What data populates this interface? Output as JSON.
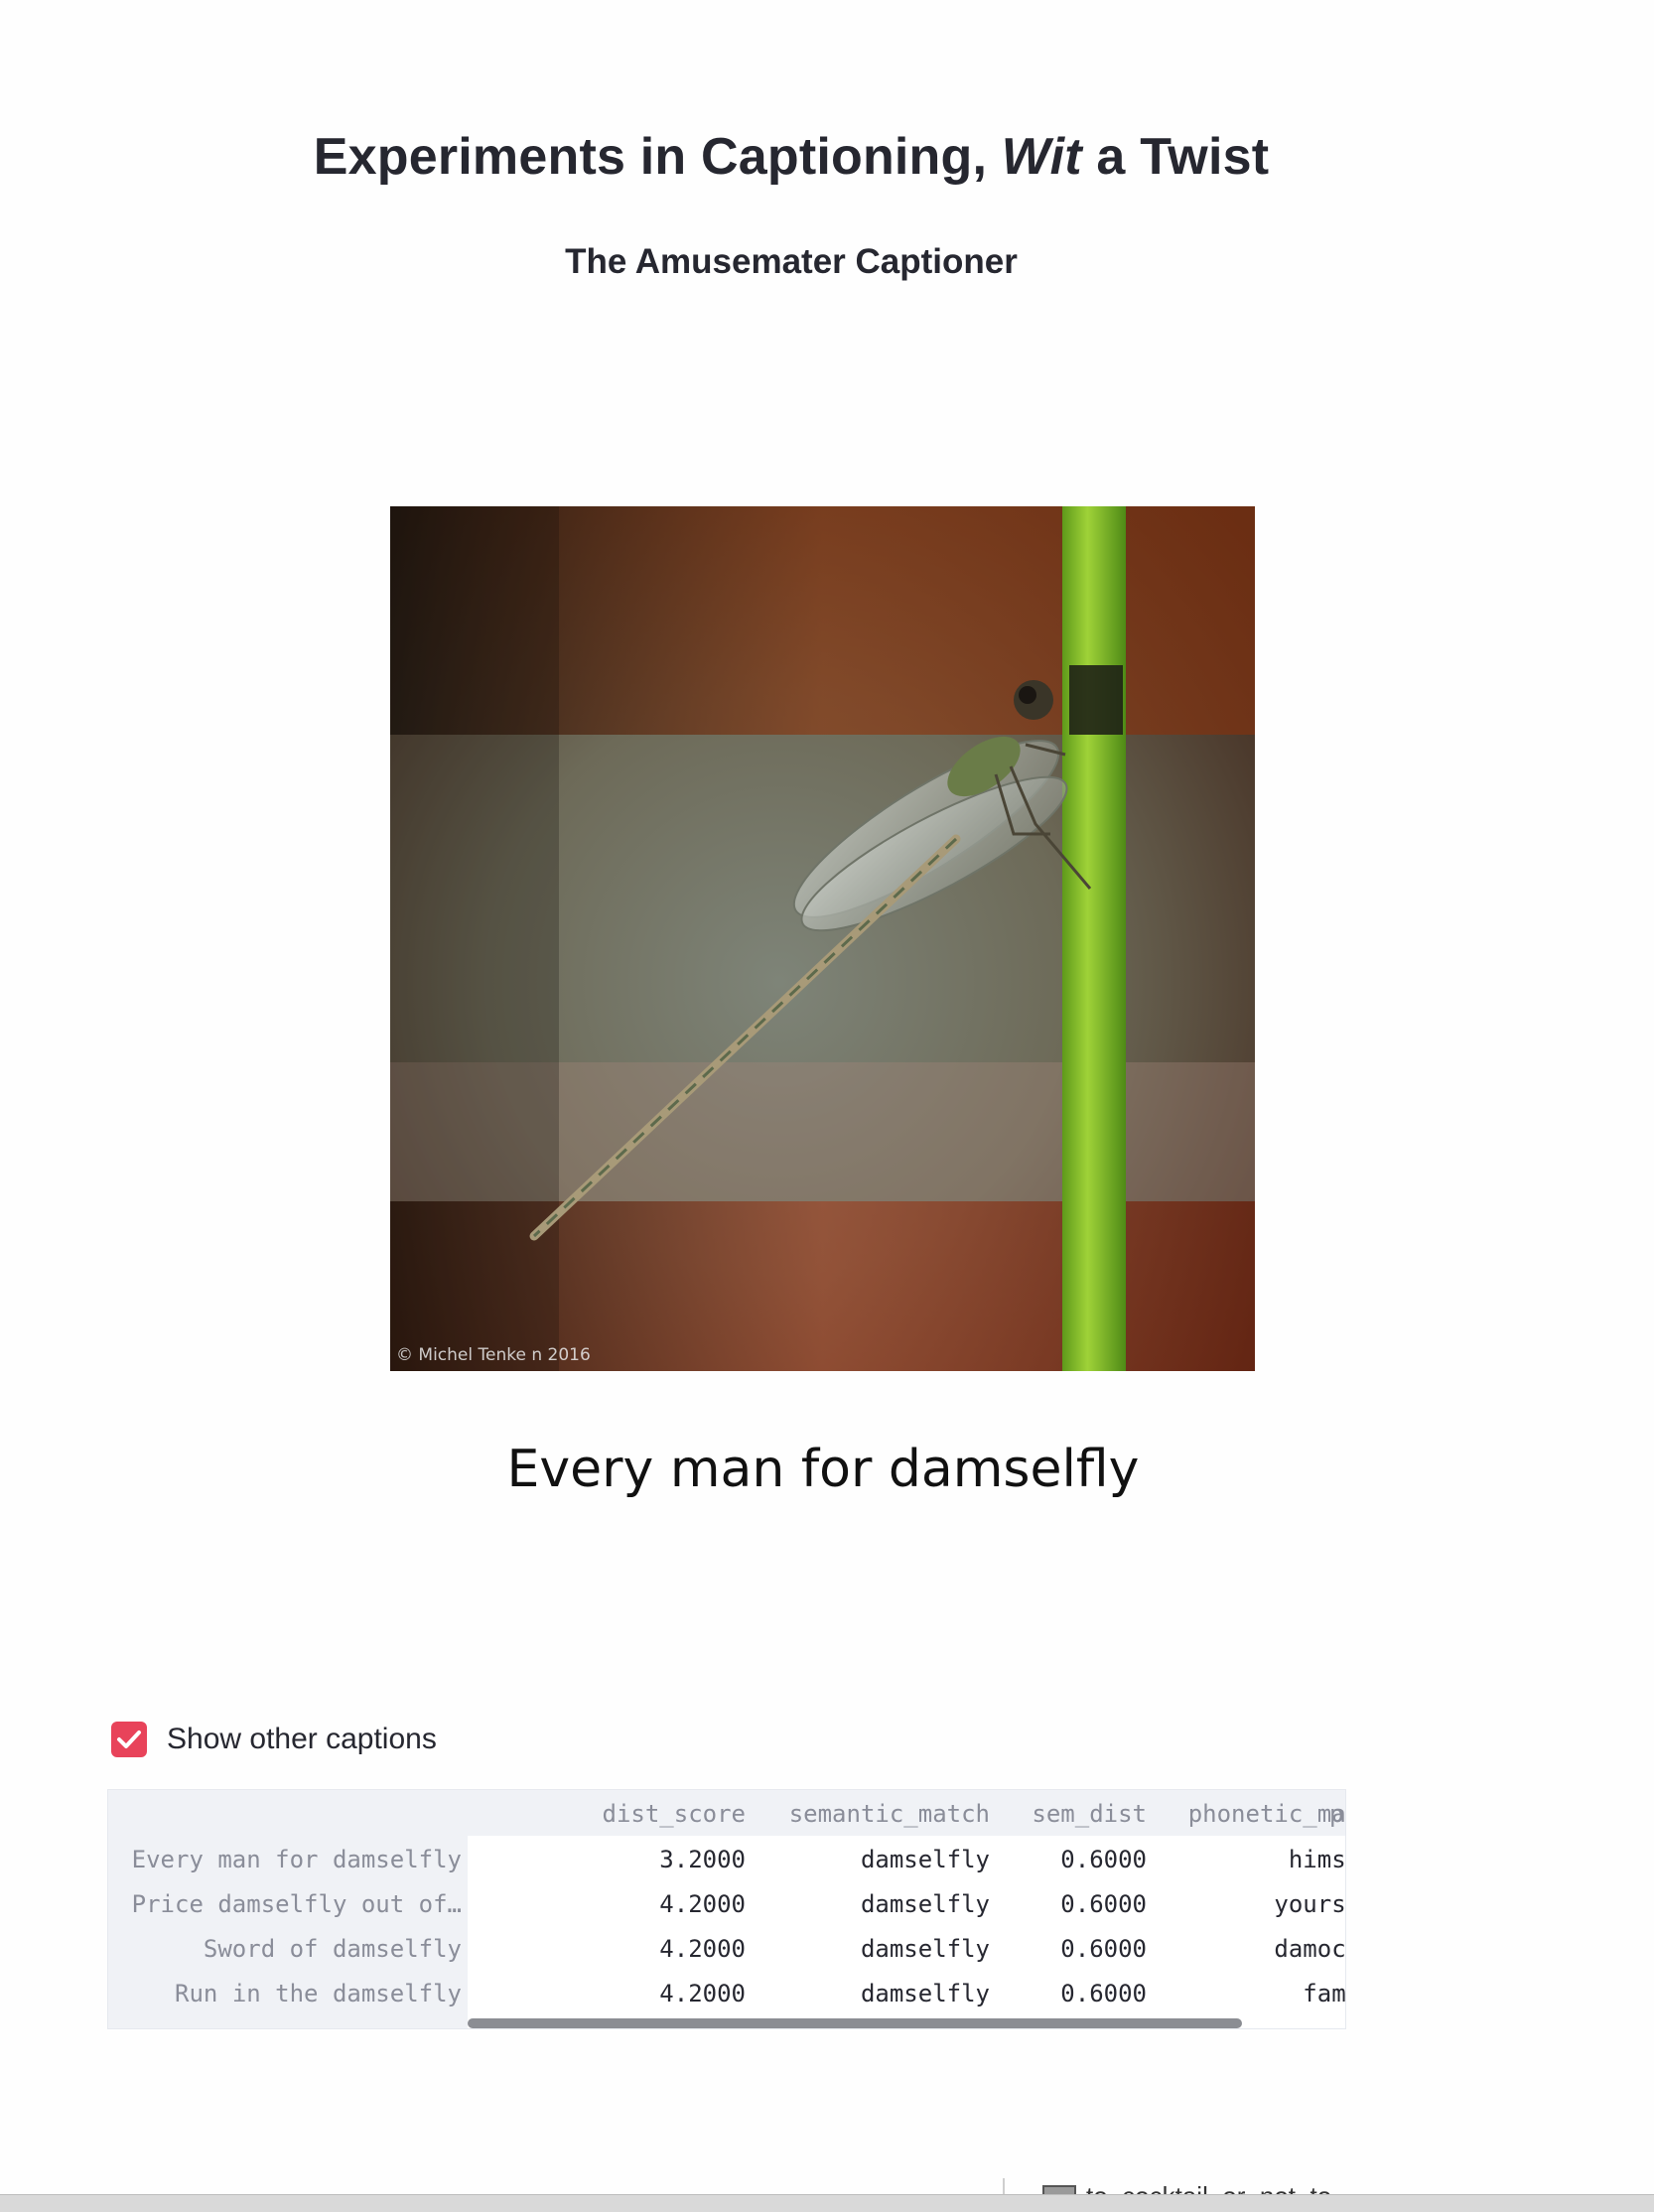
{
  "header": {
    "title_prefix": "Experiments in Captioning, ",
    "title_italic": "Wit",
    "title_suffix": " a Twist",
    "subtitle": "The Amusemater Captioner"
  },
  "image": {
    "alt": "damselfly perched on a green stem",
    "credit": "© Michel Tenke n 2016"
  },
  "caption": "Every man for damselfly",
  "toggle": {
    "label": "Show other captions",
    "checked": true,
    "color": "#e8435a"
  },
  "dataframe": {
    "columns": [
      "dist_score",
      "semantic_match",
      "sem_dist",
      "phonetic_match",
      "p"
    ],
    "rows": [
      {
        "index": "Every man for damselfly",
        "cells": [
          "3.2000",
          "damselfly",
          "0.6000",
          "himself"
        ]
      },
      {
        "index": "Price damselfly out of…",
        "cells": [
          "4.2000",
          "damselfly",
          "0.6000",
          "yourself"
        ]
      },
      {
        "index": "Sword of damselfly",
        "cells": [
          "4.2000",
          "damselfly",
          "0.6000",
          "damocles"
        ]
      },
      {
        "index": "Run in the damselfly",
        "cells": [
          "4.2000",
          "damselfly",
          "0.6000",
          "family"
        ]
      }
    ]
  },
  "bottom_bar": {
    "item_label": "to_cocktail_or_not_to"
  }
}
